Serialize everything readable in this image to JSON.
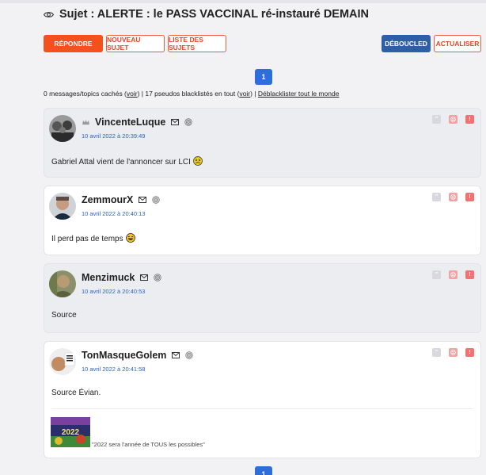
{
  "topic": {
    "title": "Sujet : ALERTE : le PASS VACCINAL ré-instauré DEMAIN",
    "eye_icon": "eye-icon"
  },
  "toolbar": {
    "reply_label": "RÉPONDRE",
    "new_topic_label": "NOUVEAU SUJET",
    "topic_list_label": "LISTE DES SUJETS",
    "debouncled_label": "DÉBOUCLED",
    "refresh_label": "ACTUALISER"
  },
  "pagination": {
    "top_page": "1",
    "bottom_page": "1"
  },
  "info": {
    "prefix": "0 messages/topics cachés (",
    "voir1": "voir",
    "middle": ") | 17 pseudos blacklistés en tout (",
    "voir2": "voir",
    "suffix": ") | ",
    "unblacklist": "Déblacklister tout le monde"
  },
  "messages": [
    {
      "author": "VincenteLuque",
      "date": "10 avril 2022 à 20:39:49",
      "text": "Gabriel Attal vient de l'annoncer sur LCI",
      "emoji": "sick-smiley-icon",
      "crown": true
    },
    {
      "author": "ZemmourX",
      "date": "10 avril 2022 à 20:40:13",
      "text": "Il perd pas de temps",
      "emoji": "laughing-smiley-icon"
    },
    {
      "author": "Menzimuck",
      "date": "10 avril 2022 à 20:40:53",
      "text": "Source"
    },
    {
      "author": "TonMasqueGolem",
      "date": "10 avril 2022 à 20:41:58",
      "text": "Source Évian.",
      "caption": "\"2022 sera l'année de TOUS les possibles\""
    }
  ],
  "colors": {
    "accent_red": "#f4511e",
    "link_blue": "#2a62c9",
    "pager_blue": "#2f6ddb",
    "debouncled_blue": "#2e5ea8"
  }
}
